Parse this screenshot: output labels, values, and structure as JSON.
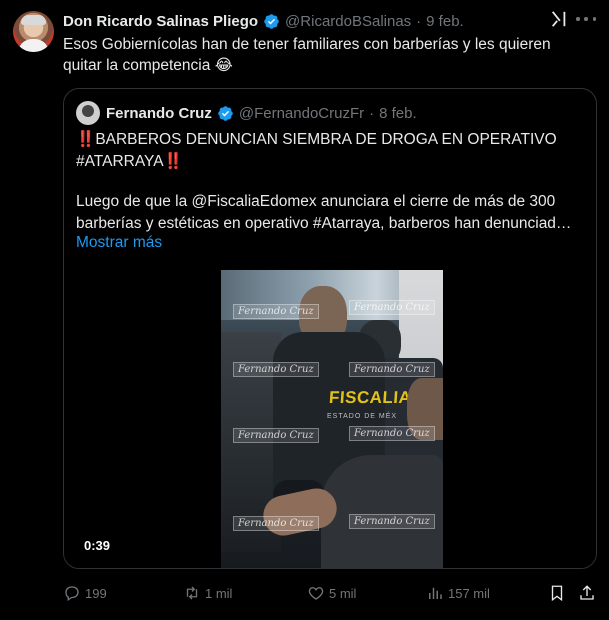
{
  "tweet": {
    "author_name": "Don Ricardo Salinas Pliego",
    "author_handle": "@RicardoBSalinas",
    "separator": "·",
    "date": "9 feb.",
    "text": "Esos Gobiernícolas han de tener familiares con barberías y les quieren quitar la competencia 😂"
  },
  "quote": {
    "author_name": "Fernando Cruz",
    "author_handle": "@FernandoCruzFr",
    "separator": "·",
    "date": "8 feb.",
    "headline_prefix": "‼️",
    "headline": "BARBEROS DENUNCIAN SIEMBRA DE DROGA EN OPERATIVO #ATARRAYA",
    "headline_suffix": "‼️",
    "body": "Luego de que la @FiscaliaEdomex anunciara el cierre de más de 300 barberías y estéticas en operativo #Atarraya, barberos han denunciad…",
    "show_more": "Mostrar más",
    "video": {
      "timecode": "0:39",
      "vest_text": "FISCALIA",
      "vest_subtext": "ESTADO DE MÉX",
      "watermark": "Fernando Cruz"
    }
  },
  "actions": {
    "replies": "199",
    "reposts": "1 mil",
    "likes": "5 mil",
    "views": "157 mil"
  },
  "colors": {
    "background": "#000000",
    "text_primary": "#e7e9ea",
    "text_secondary": "#71767b",
    "link": "#1d9bf0",
    "verified": "#1d9bf0",
    "border": "#2f3336"
  },
  "icons": {
    "verified": "verified-badge-icon",
    "grok": "grok-icon",
    "more": "more-options-icon",
    "reply": "reply-icon",
    "repost": "repost-icon",
    "like": "like-icon",
    "views": "views-icon",
    "bookmark": "bookmark-icon",
    "share": "share-icon"
  }
}
